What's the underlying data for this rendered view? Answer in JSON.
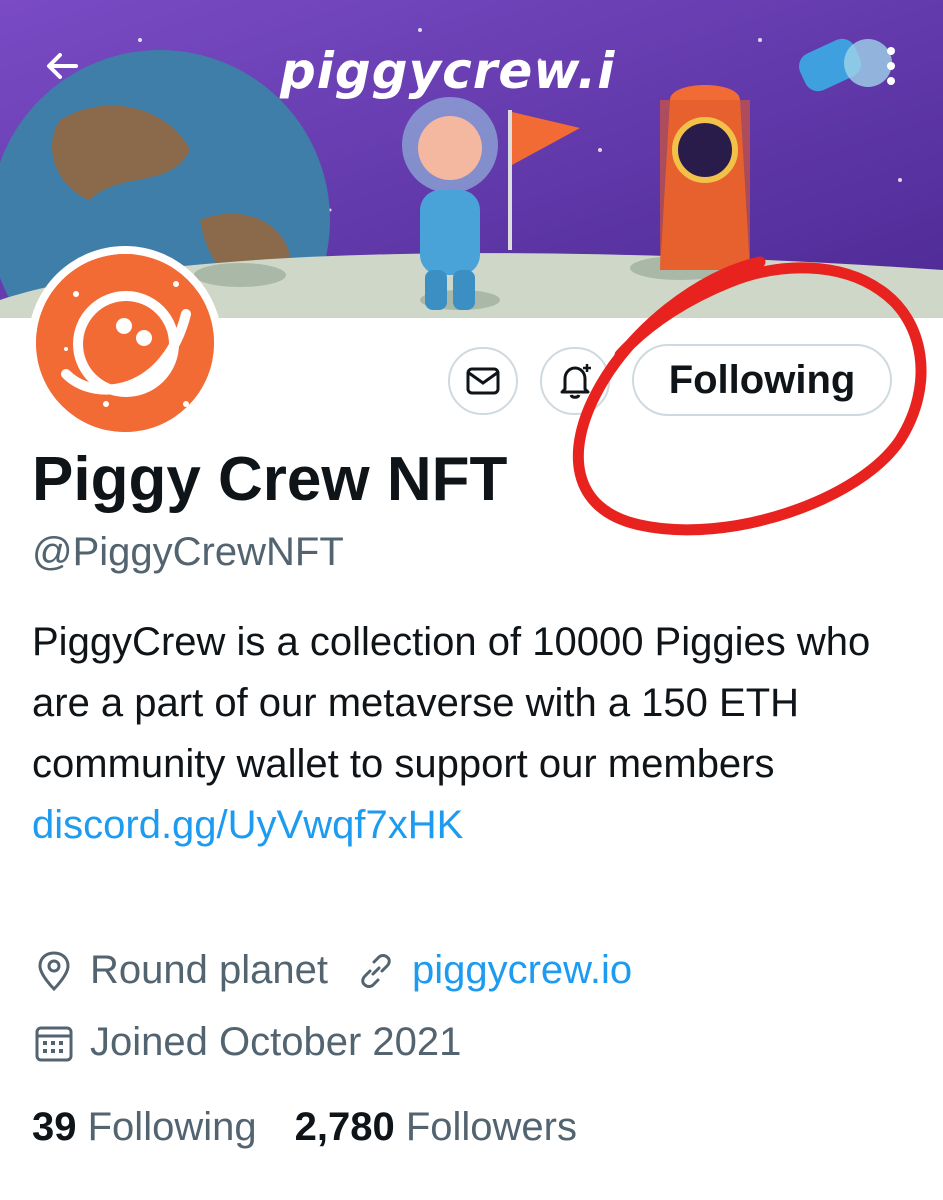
{
  "banner": {
    "brand_text": "piggycrew.i",
    "colors": {
      "sky": "#6a3fb0",
      "moon": "#cfd8c8",
      "planet": "#3f7ea8"
    }
  },
  "nav": {
    "back_icon": "arrow-left-icon",
    "more_icon": "more-vertical-icon"
  },
  "profile": {
    "display_name": "Piggy Crew NFT",
    "handle": "@PiggyCrewNFT",
    "bio_text": "PiggyCrew is a collection of 10000 Piggies who are a part of our metaverse with a 150 ETH community wallet to support our members ",
    "bio_link": "discord.gg/​UyVwqf7xHK",
    "location": "Round planet",
    "website": "piggycrew.io",
    "joined": "Joined October 2021",
    "avatar_color": "#f26b35"
  },
  "actions": {
    "message_icon": "envelope-icon",
    "notify_icon": "bell-plus-icon",
    "follow_label": "Following"
  },
  "stats": {
    "following_count": "39",
    "following_label": "Following",
    "followers_count": "2,780",
    "followers_label": "Followers"
  },
  "annotation": {
    "color": "#e8231f"
  }
}
